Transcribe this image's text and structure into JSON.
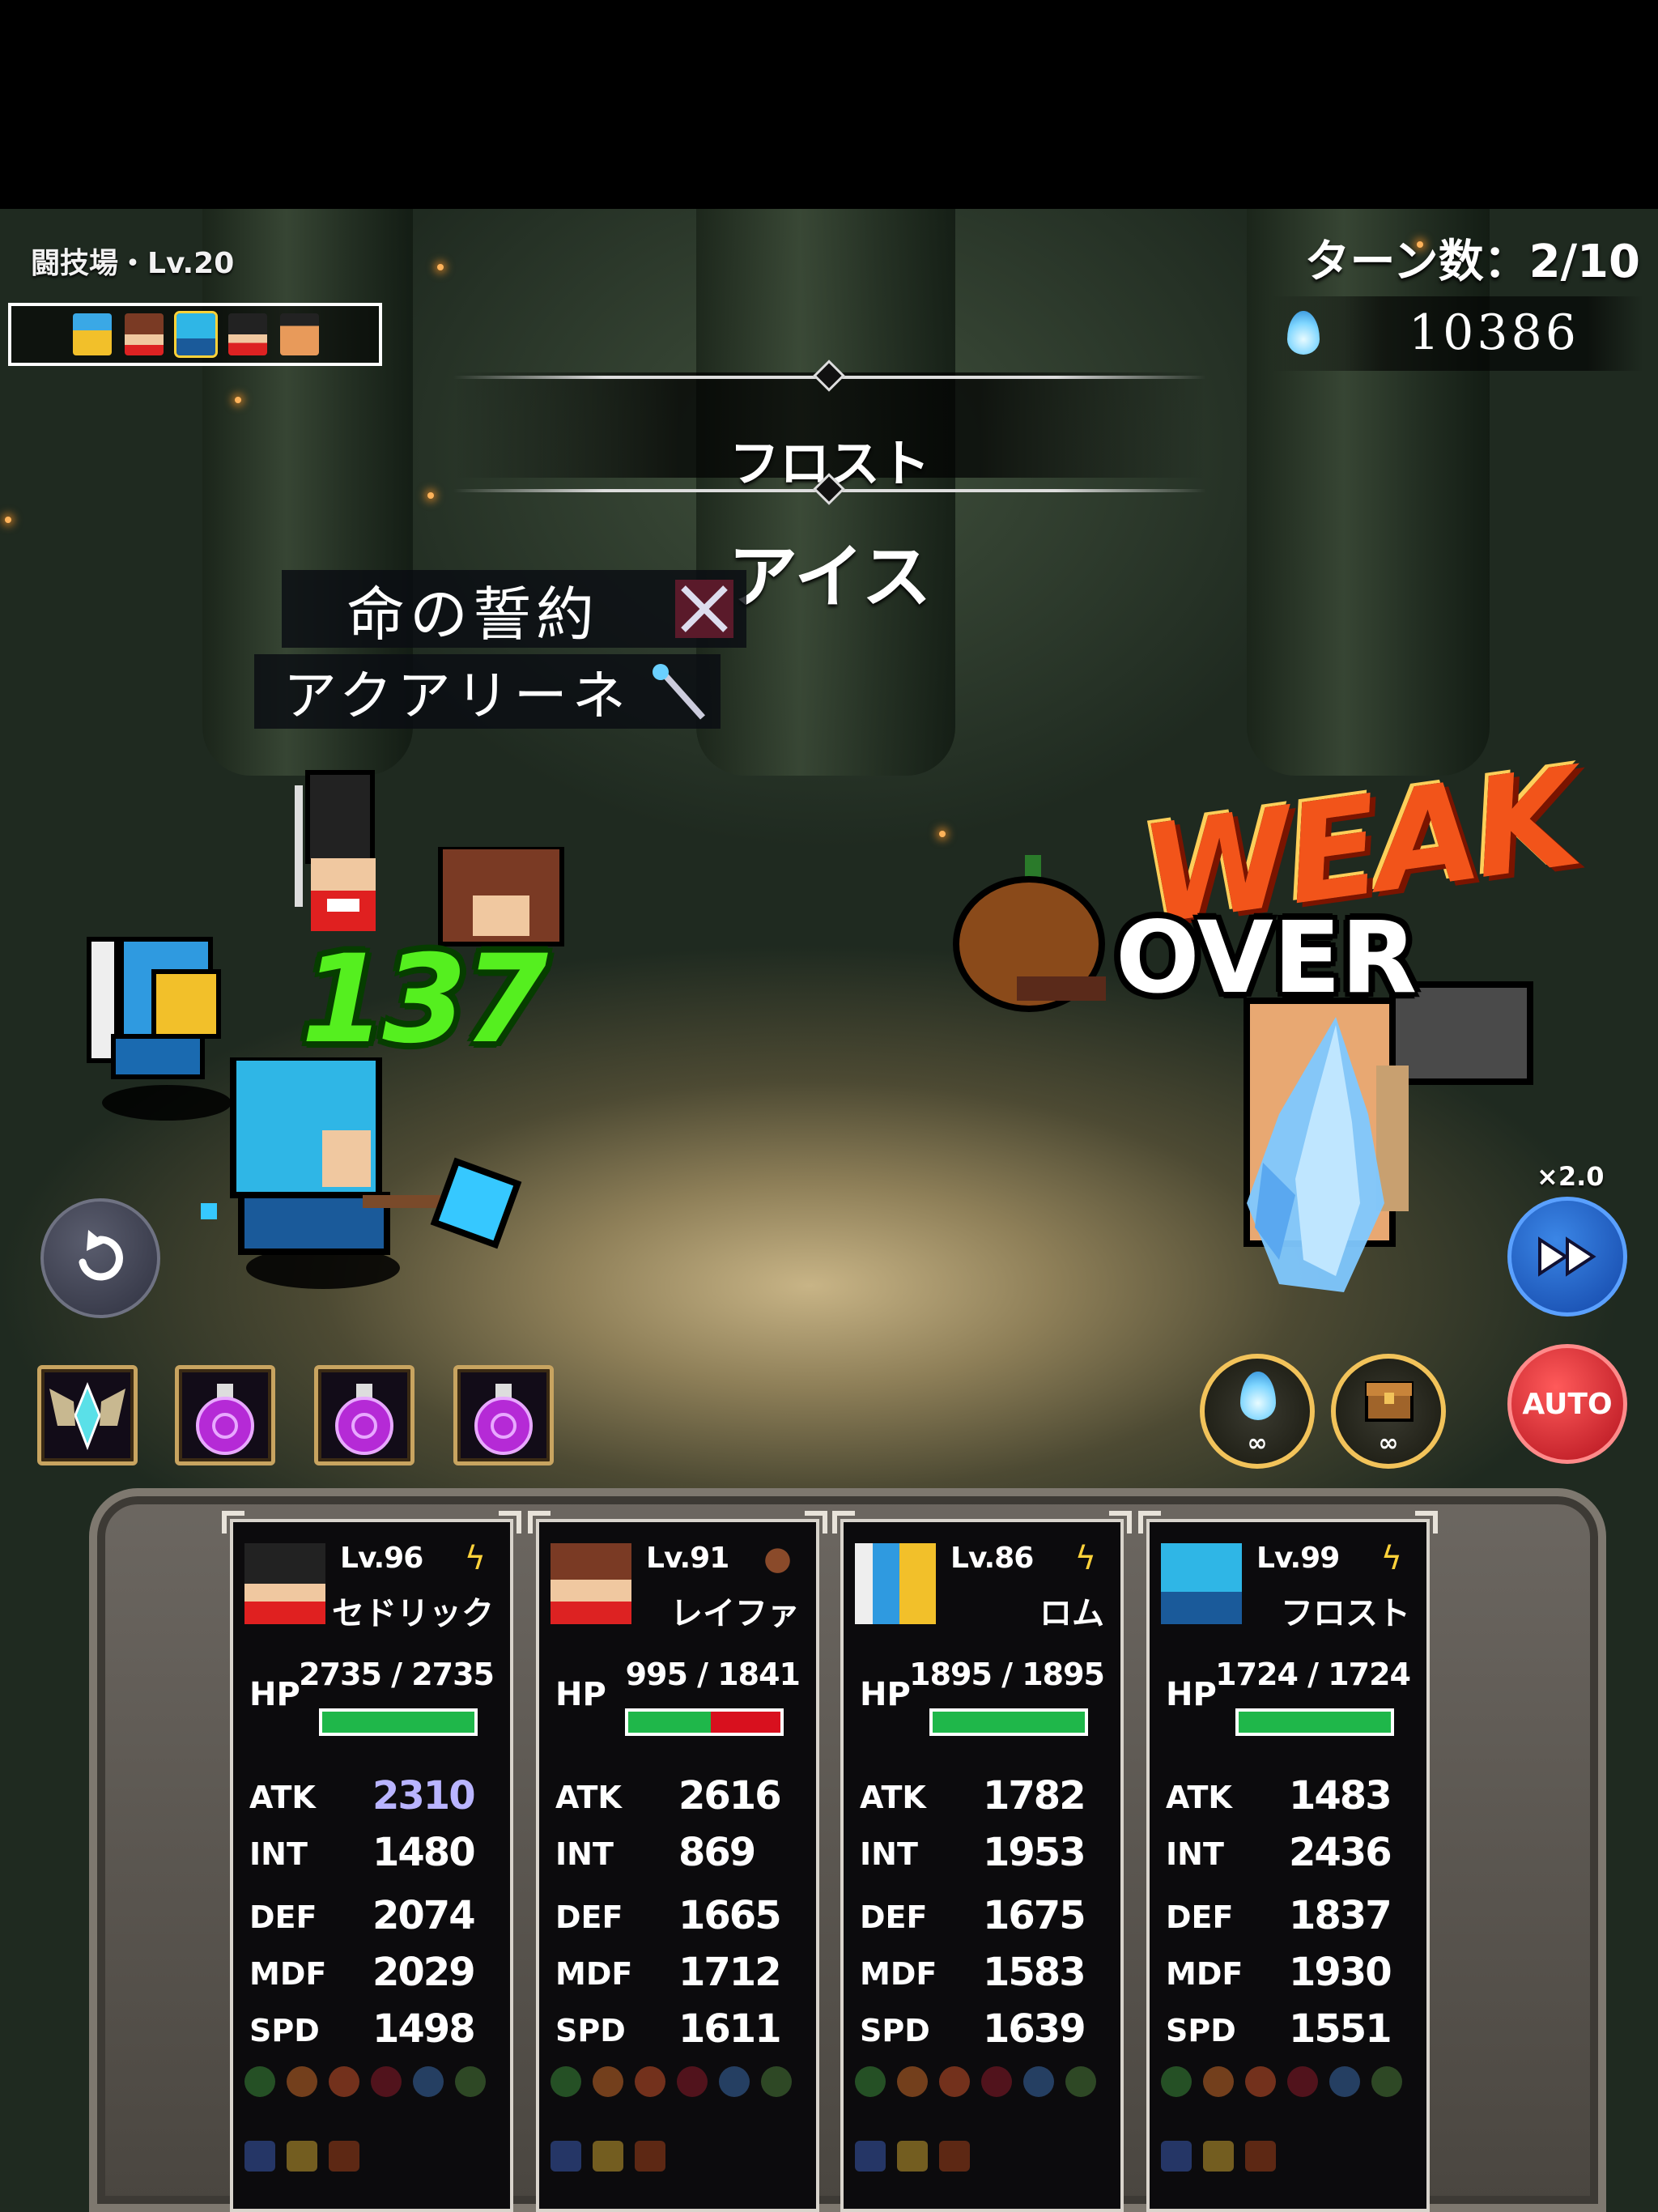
{
  "hud": {
    "arena_label": "闘技場・Lv.20",
    "turn_counter": "ターン数：2/10",
    "mana_value": "10386",
    "turn_order": [
      "rom-avatar",
      "reifa-avatar",
      "frost-avatar",
      "cedric-avatar",
      "enemy-avatar"
    ]
  },
  "action": {
    "unit_name": "フロスト",
    "skill_name": "アイス",
    "log": [
      {
        "text": "命の誓約",
        "icon": "crossed-swords-icon"
      },
      {
        "text": "アクアリーネ",
        "icon": "staff-icon"
      }
    ]
  },
  "effects": {
    "damage": "137",
    "weak": "WEAK",
    "over": "OVER"
  },
  "controls": {
    "speed_label": "×2.0",
    "auto_label": "AUTO",
    "undo_icon": "undo-icon",
    "fast_forward_icon": "fast-forward-icon"
  },
  "items": [
    {
      "name": "wing-crystal-icon"
    },
    {
      "name": "purple-potion-icon"
    },
    {
      "name": "purple-potion-icon"
    },
    {
      "name": "purple-potion-icon"
    }
  ],
  "consumables": [
    {
      "name": "water-flame-icon",
      "count": "∞"
    },
    {
      "name": "treasure-chest-icon",
      "count": "∞"
    }
  ],
  "party": [
    {
      "level": "Lv.96",
      "name": "セドリック",
      "element": "lightning-icon",
      "hp": "2735 / 2735",
      "hp_fraction": 1.0,
      "atk": "2310",
      "atk_buffed": true,
      "int": "1480",
      "def": "2074",
      "mdf": "2029",
      "spd": "1498"
    },
    {
      "level": "Lv.91",
      "name": "レイファ",
      "element": "earth-icon",
      "hp": "995 / 1841",
      "hp_fraction": 0.54,
      "atk": "2616",
      "atk_buffed": false,
      "int": "869",
      "def": "1665",
      "mdf": "1712",
      "spd": "1611"
    },
    {
      "level": "Lv.86",
      "name": "ロム",
      "element": "lightning-icon",
      "hp": "1895 / 1895",
      "hp_fraction": 1.0,
      "atk": "1782",
      "atk_buffed": false,
      "int": "1953",
      "def": "1675",
      "mdf": "1583",
      "spd": "1639"
    },
    {
      "level": "Lv.99",
      "name": "フロスト",
      "element": "lightning-icon",
      "hp": "1724 / 1724",
      "hp_fraction": 1.0,
      "atk": "1483",
      "atk_buffed": false,
      "int": "2436",
      "def": "1837",
      "mdf": "1930",
      "spd": "1551"
    }
  ],
  "stat_labels": {
    "hp": "HP",
    "atk": "ATK",
    "int": "INT",
    "def": "DEF",
    "mdf": "MDF",
    "spd": "SPD"
  },
  "colors": {
    "hp_green": "#1fb74a",
    "hp_red": "#d8101e",
    "damage_green": "#55ef1f",
    "weak_orange": "#f2541a"
  }
}
